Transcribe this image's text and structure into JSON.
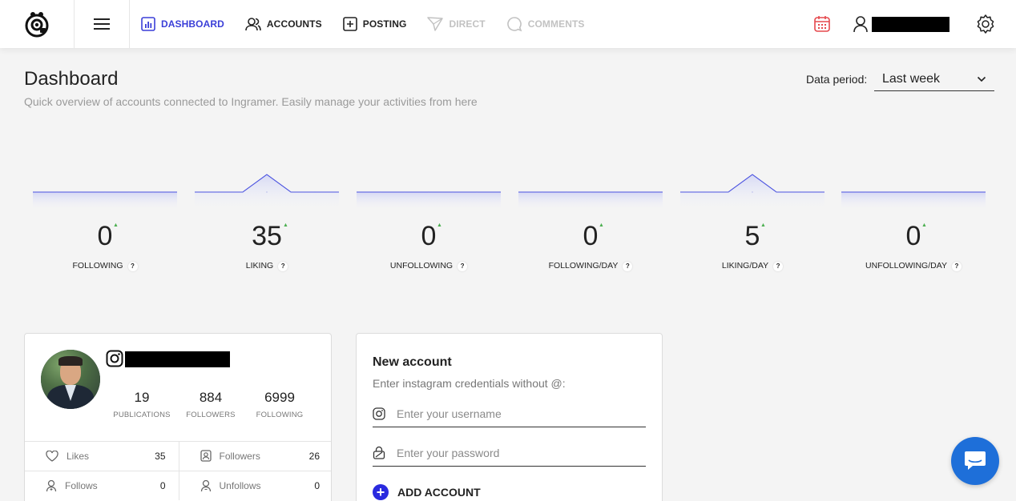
{
  "nav": {
    "items": [
      {
        "label": "DASHBOARD",
        "state": "active",
        "icon": "chart-icon"
      },
      {
        "label": "ACCOUNTS",
        "state": "normal",
        "icon": "users-icon"
      },
      {
        "label": "POSTING",
        "state": "normal",
        "icon": "plus-square-icon"
      },
      {
        "label": "DIRECT",
        "state": "disabled",
        "icon": "send-icon"
      },
      {
        "label": "COMMENTS",
        "state": "disabled",
        "icon": "comment-icon"
      }
    ]
  },
  "header": {
    "title": "Dashboard",
    "subtitle": "Quick overview of accounts connected to Ingramer. Easily manage your activities from here",
    "period_label": "Data period:",
    "period_value": "Last week"
  },
  "stats": [
    {
      "value": "0",
      "label": "FOLLOWING",
      "help": "?"
    },
    {
      "value": "35",
      "label": "LIKING",
      "help": "?"
    },
    {
      "value": "0",
      "label": "UNFOLLOWING",
      "help": "?"
    },
    {
      "value": "0",
      "label": "FOLLOWING/DAY",
      "help": "?"
    },
    {
      "value": "5",
      "label": "LIKING/DAY",
      "help": "?"
    },
    {
      "value": "0",
      "label": "UNFOLLOWING/DAY",
      "help": "?"
    }
  ],
  "profile": {
    "publications": "19",
    "publications_label": "PUBLICATIONS",
    "followers": "884",
    "followers_label": "FOLLOWERS",
    "following": "6999",
    "following_label": "FOLLOWING",
    "rows": [
      {
        "left_label": "Likes",
        "left_value": "35",
        "right_label": "Followers",
        "right_value": "26"
      },
      {
        "left_label": "Follows",
        "left_value": "0",
        "right_label": "Unfollows",
        "right_value": "0"
      }
    ]
  },
  "new_account": {
    "title": "New account",
    "hint": "Enter instagram credentials without @:",
    "username_placeholder": "Enter your username",
    "password_placeholder": "Enter your password",
    "add_label": "ADD ACCOUNT",
    "plus": "+"
  },
  "colors": {
    "accent": "#3b3fd8",
    "disabled": "#c2c2c2",
    "spark_line": "#4a52e0",
    "up_arrow": "#4caf50",
    "chat": "#1e6fd9",
    "calendar": "#e5484d"
  }
}
